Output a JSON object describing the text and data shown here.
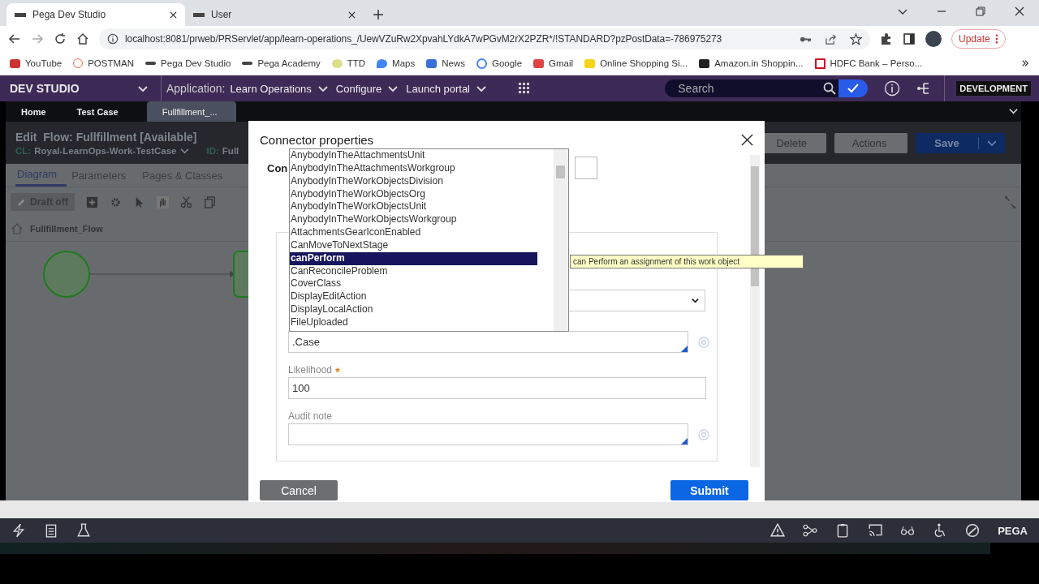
{
  "browser": {
    "tabs": [
      {
        "title": "Pega Dev Studio",
        "selected": true
      },
      {
        "title": "User",
        "selected": false
      }
    ],
    "address": "localhost:8081/prweb/PRServlet/app/learn-operations_/UewVZuRw2XpvahLYdkA7wPGvM2rX2PZR*/!STANDARD?pzPostData=-786975273",
    "update": "Update",
    "bookmarks": [
      "YouTube",
      "POSTMAN",
      "Pega Dev Studio",
      "Pega Academy",
      "TTD",
      "Maps",
      "News",
      "Google",
      "Gmail",
      "Online Shopping Si...",
      "Amazon.in Shoppin...",
      "HDFC Bank – Perso..."
    ]
  },
  "header": {
    "brand": "DEV STUDIO",
    "app_label": "Application:",
    "menus": [
      "Learn Operations",
      "Configure",
      "Launch portal"
    ],
    "search": {
      "placeholder": "Search"
    },
    "environment": "DEVELOPMENT"
  },
  "doc_tabs": [
    {
      "label": "Home",
      "selected": false
    },
    {
      "label": "Test Case",
      "selected": false
    },
    {
      "label": "Fullfillment_...",
      "selected": true
    }
  ],
  "editor": {
    "title": "Edit  Flow: Fullfillment",
    "status": "[Available]",
    "cl_label": "CL:",
    "cl_value": "Royal-LearnOps-Work-TestCase",
    "id_label": "ID:",
    "id_value": "Full",
    "buttons": [
      "Delete",
      "Actions",
      "Save"
    ]
  },
  "rule_tabs": [
    {
      "label": "Diagram",
      "selected": true
    },
    {
      "label": "Parameters",
      "selected": false
    },
    {
      "label": "Pages & Classes",
      "selected": false
    }
  ],
  "toolbar": {
    "draft": "Draft off"
  },
  "breadcrumb": "Fullfillment_Flow",
  "dialog": {
    "title": "Connector properties",
    "cut_label": "Con",
    "options": [
      {
        "label": "AnybodyInTheAttachmentsUnit",
        "selected": false
      },
      {
        "label": "AnybodyInTheAttachmentsWorkgroup",
        "selected": false
      },
      {
        "label": "AnybodyInTheWorkObjectsDivision",
        "selected": false
      },
      {
        "label": "AnybodyInTheWorkObjectsOrg",
        "selected": false
      },
      {
        "label": "AnybodyInTheWorkObjectsUnit",
        "selected": false
      },
      {
        "label": "AnybodyInTheWorkObjectsWorkgroup",
        "selected": false
      },
      {
        "label": "AttachmentsGearIconEnabled",
        "selected": false
      },
      {
        "label": "CanMoveToNextStage",
        "selected": false
      },
      {
        "label": "canPerform",
        "selected": true
      },
      {
        "label": "CanReconcileProblem",
        "selected": false
      },
      {
        "label": "CoverClass",
        "selected": false
      },
      {
        "label": "DisplayEditAction",
        "selected": false
      },
      {
        "label": "DisplayLocalAction",
        "selected": false
      },
      {
        "label": "FileUploaded",
        "selected": false
      }
    ],
    "tooltip": "can Perform an assignment of this work object",
    "fields": [
      {
        "kind": "expression",
        "value": ".Case"
      },
      {
        "kind": "input",
        "label": "Likelihood",
        "required": true,
        "value": "100"
      },
      {
        "kind": "expression",
        "label": "Audit note"
      }
    ],
    "cancel": "Cancel",
    "submit": "Submit"
  },
  "footer": {
    "brand": "PEGA"
  }
}
